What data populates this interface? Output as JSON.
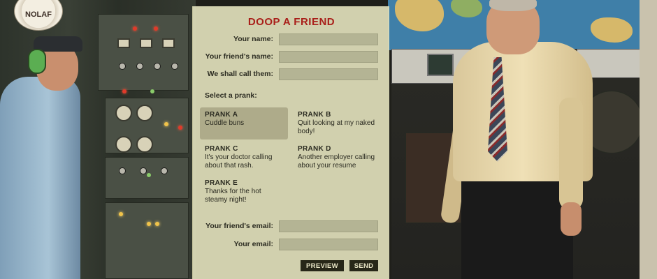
{
  "logo": {
    "text": "NOLAF"
  },
  "form": {
    "title": "DOOP A FRIEND",
    "fields_top": [
      {
        "label": "Your name:",
        "value": ""
      },
      {
        "label": "Your friend's name:",
        "value": ""
      },
      {
        "label": "We shall call them:",
        "value": ""
      }
    ],
    "select_label": "Select a prank:",
    "pranks": [
      {
        "heading": "PRANK A",
        "desc": "Cuddle buns",
        "selected": true
      },
      {
        "heading": "PRANK B",
        "desc": "Quit looking at my naked body!",
        "selected": false
      },
      {
        "heading": "PRANK C",
        "desc": "It's your doctor calling about that rash.",
        "selected": false
      },
      {
        "heading": "PRANK D",
        "desc": "Another employer calling about your resume",
        "selected": false
      },
      {
        "heading": "PRANK E",
        "desc": "Thanks for the hot steamy night!",
        "selected": false
      }
    ],
    "fields_bottom": [
      {
        "label": "Your friend's email:",
        "value": ""
      },
      {
        "label": "Your email:",
        "value": ""
      }
    ],
    "buttons": {
      "preview": "PREVIEW",
      "send": "SEND"
    }
  },
  "colors": {
    "panel_bg": "#dfdeba",
    "title_red": "#a91f1a",
    "input_bg": "#b4b494",
    "button_bg": "#272718"
  }
}
